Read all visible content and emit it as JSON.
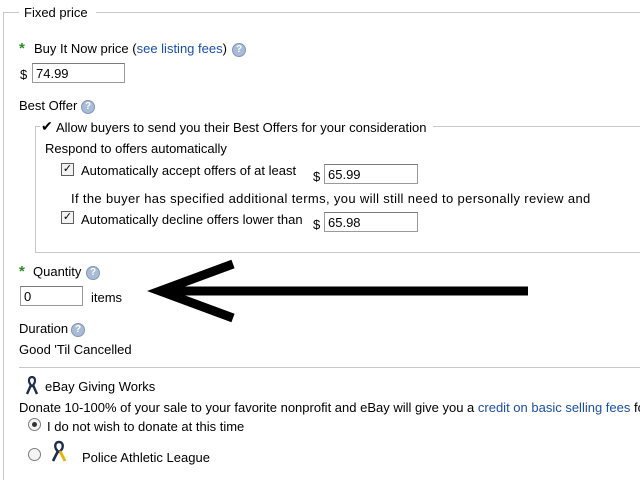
{
  "fixed_price": {
    "legend": "Fixed price",
    "bin_label": "Buy It Now price (",
    "bin_link": "see listing fees",
    "bin_close": ")",
    "currency": "$",
    "bin_value": "74.99"
  },
  "best_offer": {
    "label": "Best Offer",
    "allow_label": "Allow buyers to send you their Best Offers for your consideration",
    "respond_label": "Respond to offers automatically",
    "accept_label": "Automatically accept offers of at least",
    "accept_currency": "$",
    "accept_value": "65.99",
    "note": "If the buyer has specified additional terms, you will still need to personally review and",
    "decline_label": "Automatically decline offers lower than",
    "decline_currency": "$",
    "decline_value": "65.98"
  },
  "quantity": {
    "label": "Quantity",
    "value": "0",
    "unit": "items"
  },
  "duration": {
    "label": "Duration",
    "value": "Good 'Til Cancelled"
  },
  "giving": {
    "title": "eBay Giving Works",
    "desc": "Donate 10-100% of your sale to your favorite nonprofit and eBay will give you a ",
    "desc_link": "credit on basic selling fees",
    "desc_tail": " fo",
    "option_none": "I do not wish to donate at this time",
    "option_charity": "Police Athletic League",
    "selected": "none"
  },
  "colors": {
    "star": "#2a8a2a",
    "link": "#1a4fa8",
    "arrow": "#000000"
  },
  "icons": {
    "help": "help-icon",
    "checkmark": "checkmark-icon",
    "ribbon": "ribbon-icon"
  }
}
